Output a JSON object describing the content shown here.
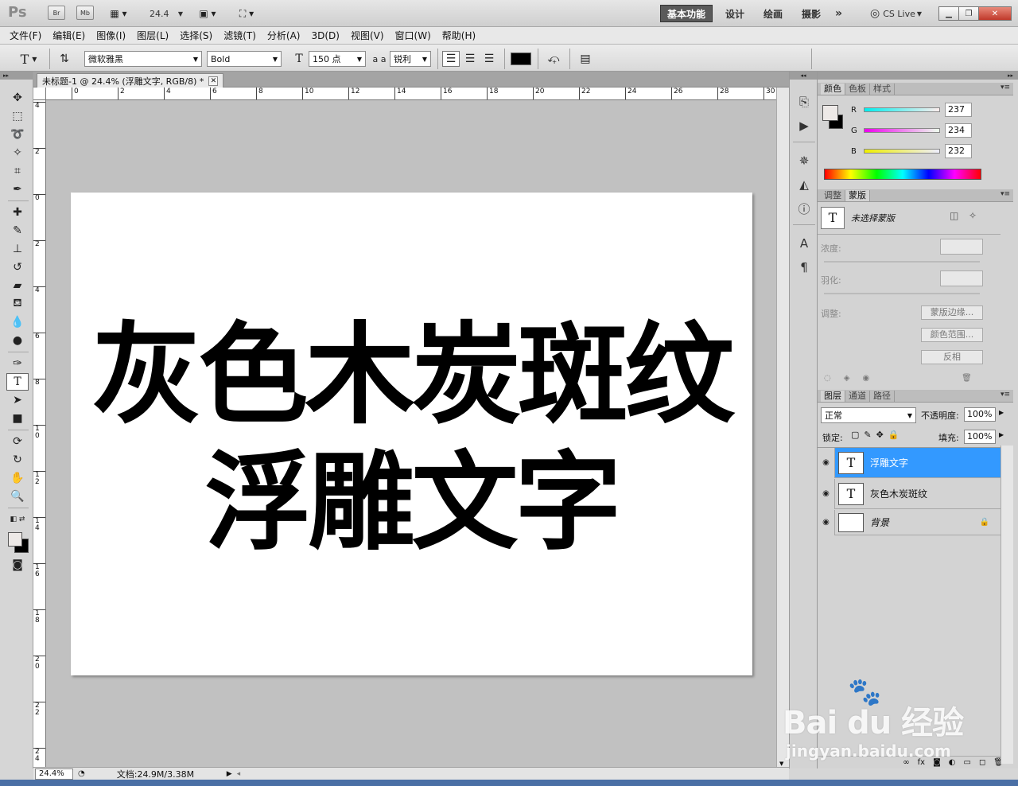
{
  "appbar": {
    "logo": "Ps",
    "bridge": "Br",
    "minibridge": "Mb",
    "zoom_value": "24.4",
    "workspaces": [
      "基本功能",
      "设计",
      "绘画",
      "摄影"
    ],
    "more": "»",
    "cslive": "CS Live"
  },
  "menu": [
    "文件(F)",
    "编辑(E)",
    "图像(I)",
    "图层(L)",
    "选择(S)",
    "滤镜(T)",
    "分析(A)",
    "3D(D)",
    "视图(V)",
    "窗口(W)",
    "帮助(H)"
  ],
  "options": {
    "font_family": "微软雅黑",
    "font_style": "Bold",
    "font_size": "150 点",
    "antialias_label": "a a",
    "antialias": "锐利"
  },
  "document": {
    "tab_title": "未标题-1 @ 24.4% (浮雕文字, RGB/8) *",
    "line1": "灰色木炭斑纹",
    "line2": "浮雕文字",
    "ruler_h": [
      "0",
      "2",
      "4",
      "6",
      "8",
      "10",
      "12",
      "14",
      "16",
      "18",
      "20",
      "22",
      "24",
      "26",
      "28",
      "30"
    ],
    "ruler_v": [
      "4",
      "2",
      "0",
      "2",
      "4",
      "6",
      "8",
      "1 0",
      "1 2",
      "1 4",
      "1 6",
      "1 8",
      "2 0",
      "2 2",
      "2 4"
    ]
  },
  "status": {
    "zoom": "24.4%",
    "doc_info": "文档:24.9M/3.38M"
  },
  "color_panel": {
    "tabs": [
      "颜色",
      "色板",
      "样式"
    ],
    "r_label": "R",
    "r_value": "237",
    "g_label": "G",
    "g_value": "234",
    "b_label": "B",
    "b_value": "232"
  },
  "mask_panel": {
    "tabs": [
      "调整",
      "蒙版"
    ],
    "no_mask": "未选择蒙版",
    "density": "浓度:",
    "feather": "羽化:",
    "adjust": "调整:",
    "btn_edge": "蒙版边缘...",
    "btn_range": "颜色范围...",
    "btn_invert": "反相"
  },
  "layers_panel": {
    "tabs": [
      "图层",
      "通道",
      "路径"
    ],
    "blend_mode": "正常",
    "opacity_label": "不透明度:",
    "opacity": "100%",
    "lock_label": "锁定:",
    "fill_label": "填充:",
    "fill": "100%",
    "layers": [
      {
        "name": "浮雕文字",
        "thumb": "T"
      },
      {
        "name": "灰色木炭斑纹",
        "thumb": "T"
      },
      {
        "name": "背景",
        "thumb": ""
      }
    ]
  },
  "watermark": {
    "brand": "Bai du 经验",
    "url": "jingyan.baidu.com"
  },
  "colors": {
    "selection": "#3399ff",
    "canvas_bg": "#c1c1c1",
    "text": "#000000"
  }
}
